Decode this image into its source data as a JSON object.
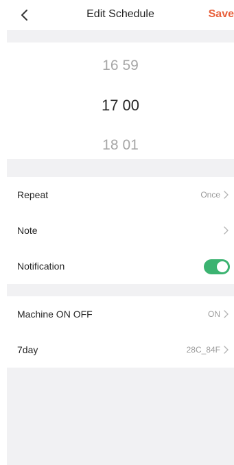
{
  "header": {
    "title": "Edit Schedule",
    "save_label": "Save"
  },
  "time_picker": {
    "previous": {
      "hour": "16",
      "minute": "59"
    },
    "selected": {
      "hour": "17",
      "minute": "00"
    },
    "next": {
      "hour": "18",
      "minute": "01"
    }
  },
  "settings": {
    "repeat": {
      "label": "Repeat",
      "value": "Once"
    },
    "note": {
      "label": "Note",
      "value": ""
    },
    "notification": {
      "label": "Notification",
      "enabled": true
    }
  },
  "machine": {
    "power": {
      "label": "Machine ON OFF",
      "value": "ON"
    },
    "device": {
      "label": "7day",
      "value": "28C_84F"
    }
  },
  "colors": {
    "accent": "#e8603c",
    "toggle_on": "#3cb371",
    "background": "#f1f1f3"
  }
}
